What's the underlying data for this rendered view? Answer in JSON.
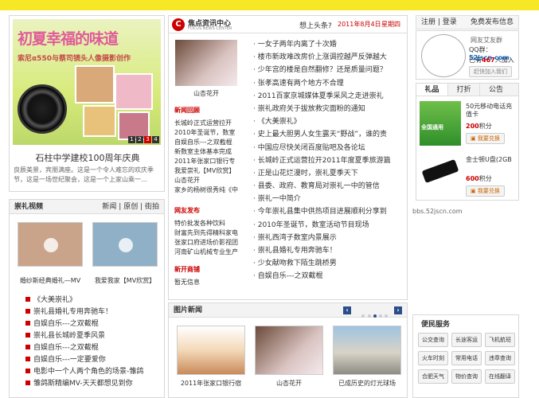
{
  "left": {
    "banner": {
      "headline": "初夏幸福的味道",
      "sub": "索尼α550与蔡司镜头人像摄影创作",
      "pager": [
        "1",
        "2",
        "3",
        "4"
      ],
      "caption": "石柱中学建校100周年庆典",
      "desc": "良辰美景，宾朋满座。这是一个令人难忘的欢庆季节，这是一场世纪聚会，这是一个上家山乘一…"
    },
    "video": {
      "title": "崇礼视频",
      "tabs": [
        "新闻",
        "原创",
        "街拍"
      ],
      "items": [
        {
          "caption": "婚纱斯经典婚礼—MV"
        },
        {
          "caption": "我爱我家【MV欣赏】"
        }
      ],
      "list": [
        "《大美崇礼》",
        "崇礼县婚礼专用奔驰车！",
        "自娱自乐---之双截棍",
        "崇礼县长城岭夏季风景",
        "自娱自乐---之双截棍",
        "自娱自乐---一定要爱你",
        "电影中一个人两个角色的场景-雏鸽",
        "雏鸽斯精编MV-天天都想见到你"
      ]
    }
  },
  "mid": {
    "brand": {
      "logo": "C",
      "name": "焦点资讯中心",
      "en": "FOCUS NEWS CENTER"
    },
    "headline_q": "想上头条?",
    "date": "2011年8月4日",
    "weekday": "星期四",
    "thumb_caption": "山杏花开",
    "sections": [
      {
        "title": "新闻回顾",
        "items": [
          "长城岭正式运营拉开",
          "2010年圣诞节，数室",
          "自娱自乐---之双截棍",
          "新数室主体基本完成",
          "2011年张家口银行专",
          "我爱崇礼【MV欣赏】",
          "山杏花开",
          "家乡的杨树很秀纯《中"
        ]
      },
      {
        "title": "网友发布",
        "items": [
          "特价批发各种饮料",
          "财富先到先得精科家电",
          "张家口府进场价影视团",
          "河南矿山机械专业生产"
        ]
      },
      {
        "title": "新开商铺",
        "items": [
          "暂无信息"
        ]
      }
    ],
    "headlines": [
      "一女子两年内离了十次婚",
      "楼市新政难改房价上涨调控越严反弹越大",
      "少年宫的楼是自然翻修？还是质量问题？",
      "张孝高速有两个地方不合理",
      "2011百家京城媒体夏季采风之走进崇礼",
      "崇礼政府关于拔放救灾面粉的通知",
      "《大美崇礼》",
      "史上最大胆男人女生露天“野战”，谁的责",
      "中国应尽快关闭百度贴吧及各论坛",
      "长城岭正式运营拉开2011年度夏季旅游篇",
      "正是山花烂漫时，崇礼夏季天下",
      "县委、政府、教育局对崇礼一中的管信",
      "崇礼一中简介",
      "今年崇礼县集中供热项目进展顺利分享到",
      "2010年圣诞节，数室活动节目现场",
      "崇礼西湾子数室内景展示",
      "崇礼县婚礼专用奔驰车！",
      "少女献吻救下陌生跳桥男",
      "自娱自乐---之双截棍"
    ],
    "photo_news": {
      "title": "图片新闻",
      "items": [
        "2011年张家口银行宿",
        "山杏花开",
        "已成历史的灯光球场"
      ]
    }
  },
  "right": {
    "topnav": {
      "register": "注册",
      "login": "登录",
      "post": "免费发布信息"
    },
    "user": {
      "name": "网友艾友群",
      "qq_label": "QQ群：",
      "site": "52jscn.com",
      "count_pre": "已有",
      "count": "467",
      "count_post": "人加入",
      "join": "赶快加入我们"
    },
    "tabs": [
      "礼品",
      "打折",
      "公告"
    ],
    "gifts": [
      {
        "name": "50元移动电话充值卡",
        "points": "200",
        "unit": "积分",
        "btn": "我要兑换",
        "brand": "全国通用"
      },
      {
        "name": "金士顿U盘(2GB",
        "points": "600",
        "unit": "积分",
        "btn": "我要兑换"
      }
    ],
    "link": "bbs.52jscn.com",
    "service": {
      "title": "便民服务",
      "items": [
        "公交查询",
        "长途客运",
        "飞机航班",
        "火车时刻",
        "常用电话",
        "违章查询",
        "合肥天气",
        "物价查询",
        "在线翻译"
      ]
    }
  }
}
